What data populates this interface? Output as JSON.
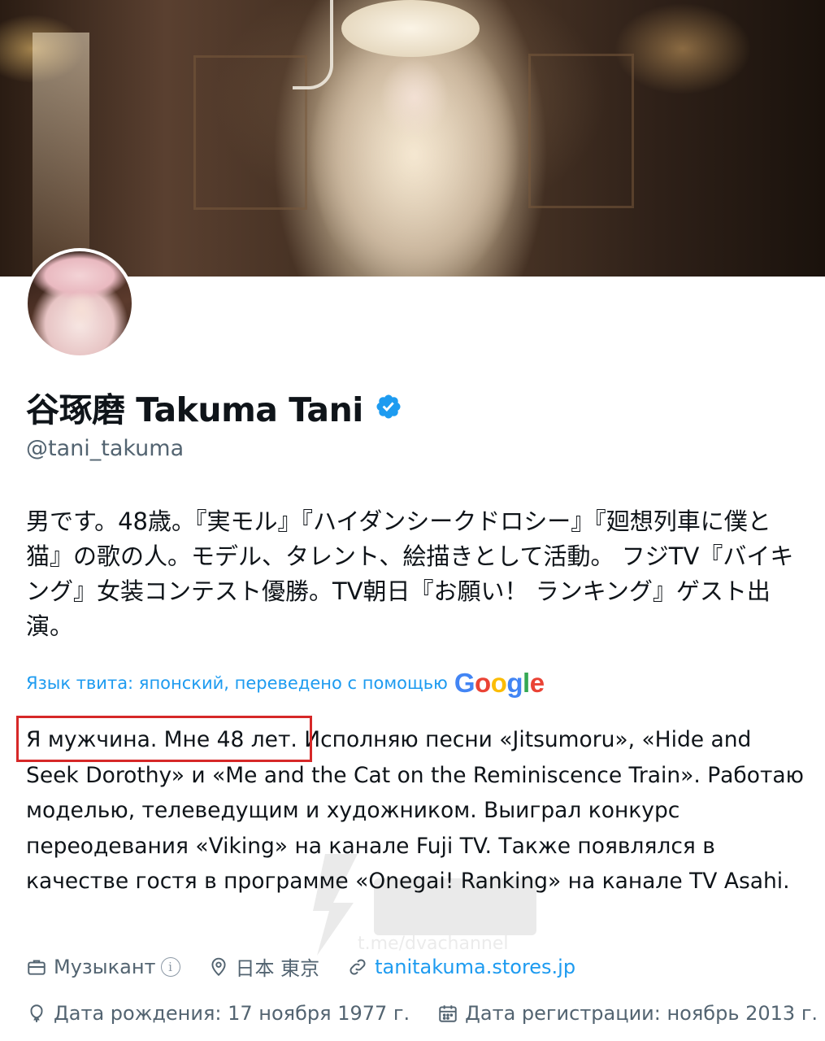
{
  "profile": {
    "display_name": "谷琢磨 Takuma Tani",
    "handle": "@tani_takuma",
    "bio_original": "男です。48歳。『実モル』『ハイダンシークドロシー』『廻想列車に僕と猫』の歌の人。モデル、タレント、絵描きとして活動。 フジTV『バイキング』女装コンテスト優勝。TV朝日『お願い！ ランキング』ゲスト出演。",
    "translation_label": "Язык твита: японский, переведено с помощью",
    "translation_provider": [
      "G",
      "o",
      "o",
      "g",
      "l",
      "e"
    ],
    "bio_translated": "Я мужчина. Мне 48 лет. Исполняю песни «Jitsumoru», «Hide and Seek Dorothy» и «Me and the Cat on the Reminiscence Train». Работаю моделью, телеведущим и художником. Выиграл конкурс переодевания «Viking» на канале Fuji TV. Также появлялся в качестве гостя в программе «Onegai! Ranking» на канале TV Asahi."
  },
  "meta": {
    "profession": "Музыкант",
    "profession_info": "i",
    "location": "日本 東京",
    "website": "tanitakuma.stores.jp",
    "birthday": "Дата рождения: 17 ноября 1977 г.",
    "joined": "Дата регистрации: ноябрь 2013 г."
  },
  "watermark": {
    "text": "t.me/dvachannel"
  },
  "colors": {
    "link": "#1d9bf0",
    "secondary_text": "#536471",
    "highlight": "#d62828",
    "verified": "#1d9bf0"
  },
  "icons": {
    "verified": "verified-badge-icon",
    "profession": "briefcase-icon",
    "location": "location-pin-icon",
    "website": "link-icon",
    "birthday": "balloon-icon",
    "joined": "calendar-icon"
  }
}
